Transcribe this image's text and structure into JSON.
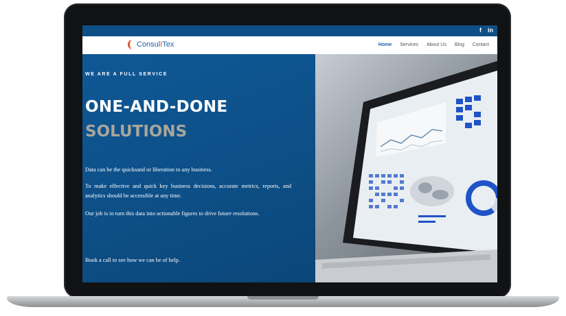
{
  "header": {
    "social": [
      "f",
      "in"
    ],
    "logo": {
      "main": "Consul",
      "accent": "I",
      "tail": "Tex"
    },
    "nav": [
      "Home",
      "Services",
      "About Us",
      "Blog",
      "Contact"
    ],
    "active_nav": "Home"
  },
  "hero": {
    "eyebrow": "WE ARE A FULL SERVICE",
    "title_line1": "ONE-AND-DONE",
    "title_line2": "SOLUTIONS",
    "p1": "Data can be the quicksand or liberation to any business.",
    "p2": "To make effective and quick key business decisions, accurate metrics, reports, and analytics should be accessible at any time.",
    "p3": "Our job is to turn this data into actionable figures to drive future resolutions.",
    "p4": "Book a call to see how we can be of help."
  },
  "colors": {
    "brand_blue": "#0d4f87",
    "accent_orange": "#e0502a",
    "muted_title": "#a8a69c"
  },
  "icons": [
    "facebook-icon",
    "linkedin-icon",
    "logo-mark-icon"
  ]
}
